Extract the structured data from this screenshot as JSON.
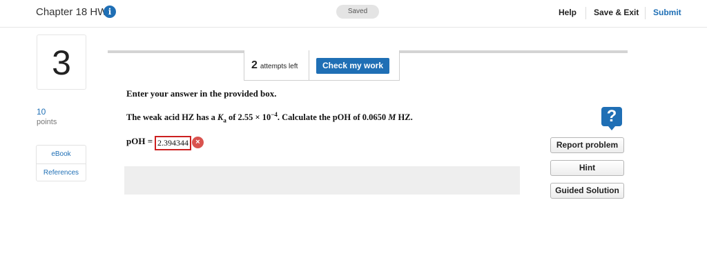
{
  "header": {
    "title": "Chapter 18 HW",
    "info_icon": "i",
    "saved_status": "Saved",
    "help": "Help",
    "save_exit": "Save & Exit",
    "submit": "Submit"
  },
  "question_meta": {
    "number": "3",
    "points_value": "10",
    "points_label": "points",
    "resources": [
      "eBook",
      "References"
    ]
  },
  "attempts": {
    "count": "2",
    "label": "attempts left",
    "check_button": "Check my work"
  },
  "question": {
    "instruction": "Enter your answer in the provided box.",
    "text_part1": "The weak acid HZ has a ",
    "ka_symbol": "K",
    "ka_sub": "a",
    "text_part2": " of 2.55 × 10",
    "exponent": "−4",
    "text_part3": ". Calculate the pOH of 0.0650 ",
    "molarity": "M",
    "text_part4": " HZ.",
    "answer_label": "pOH =",
    "answer_value": "2.394344",
    "answer_status": "incorrect",
    "wrong_icon": "×"
  },
  "side_panel": {
    "help_icon": "?",
    "report_problem": "Report problem",
    "hint": "Hint",
    "guided_solution": "Guided Solution"
  },
  "colors": {
    "accent": "#1f6fb5",
    "error": "#cc1f1f",
    "error_badge": "#d9534f"
  }
}
